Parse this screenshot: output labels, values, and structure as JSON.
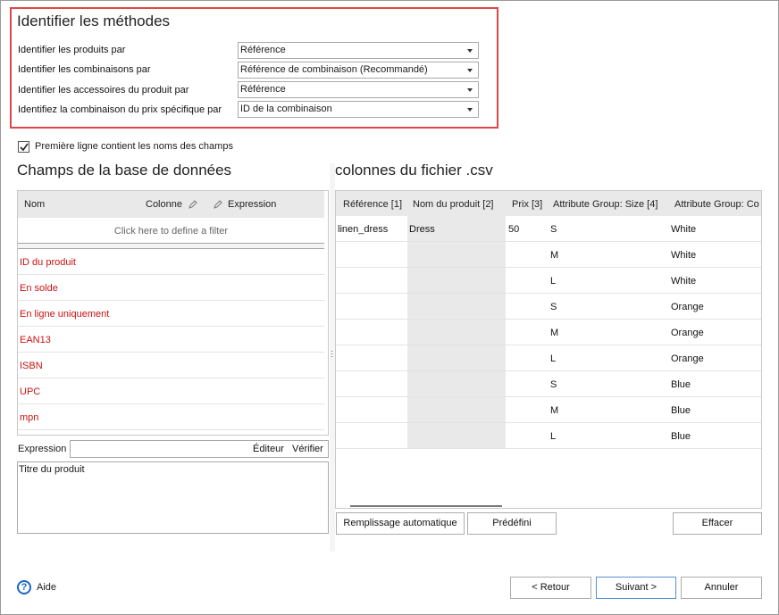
{
  "methods": {
    "title": "Identifier les méthodes",
    "rows": [
      {
        "label": "Identifier les produits par",
        "value": "Référence"
      },
      {
        "label": "Identifier les combinaisons par",
        "value": "Référence de combinaison (Recommandé)"
      },
      {
        "label": "Identifier les accessoires du produit par",
        "value": "Référence"
      },
      {
        "label": "Identifiez la combinaison du prix spécifique par",
        "value": "ID de la combinaison"
      }
    ]
  },
  "header_row_checkbox": {
    "label": "Première ligne contient les noms des champs",
    "checked": true
  },
  "db": {
    "title": "Champs de la base de données",
    "col_name": "Nom",
    "col_column": "Colonne",
    "col_expression": "Expression",
    "filter_hint": "Click here to define a filter",
    "fields": [
      "ID du produit",
      "En solde",
      "En ligne uniquement",
      "EAN13",
      "ISBN",
      "UPC",
      "mpn"
    ],
    "field_color": "#cc1111"
  },
  "expression": {
    "label": "Expression",
    "editor_label": "Éditeur",
    "verify_label": "Vérifier",
    "text": "Titre du produit"
  },
  "csv": {
    "title": "colonnes du fichier .csv",
    "headers": [
      "Référence [1]",
      "Nom du produit [2]",
      "Prix [3]",
      "Attribute Group: Size [4]",
      "Attribute Group: Co"
    ],
    "rows": [
      [
        "linen_dress",
        "Dress",
        "50",
        "S",
        "White"
      ],
      [
        "",
        "",
        "",
        "M",
        "White"
      ],
      [
        "",
        "",
        "",
        "L",
        "White"
      ],
      [
        "",
        "",
        "",
        "S",
        "Orange"
      ],
      [
        "",
        "",
        "",
        "M",
        "Orange"
      ],
      [
        "",
        "",
        "",
        "L",
        "Orange"
      ],
      [
        "",
        "",
        "",
        "S",
        "Blue"
      ],
      [
        "",
        "",
        "",
        "M",
        "Blue"
      ],
      [
        "",
        "",
        "",
        "L",
        "Blue"
      ]
    ],
    "autofill_label": "Remplissage automatique",
    "preset_label": "Prédéfini",
    "clear_label": "Effacer"
  },
  "footer": {
    "help_label": "Aide",
    "help_icon": "question-circle-icon",
    "back_label": "< Retour",
    "next_label": "Suivant >",
    "cancel_label": "Annuler"
  },
  "colors": {
    "highlight_border": "#e04646",
    "help_blue": "#1a66c2"
  }
}
